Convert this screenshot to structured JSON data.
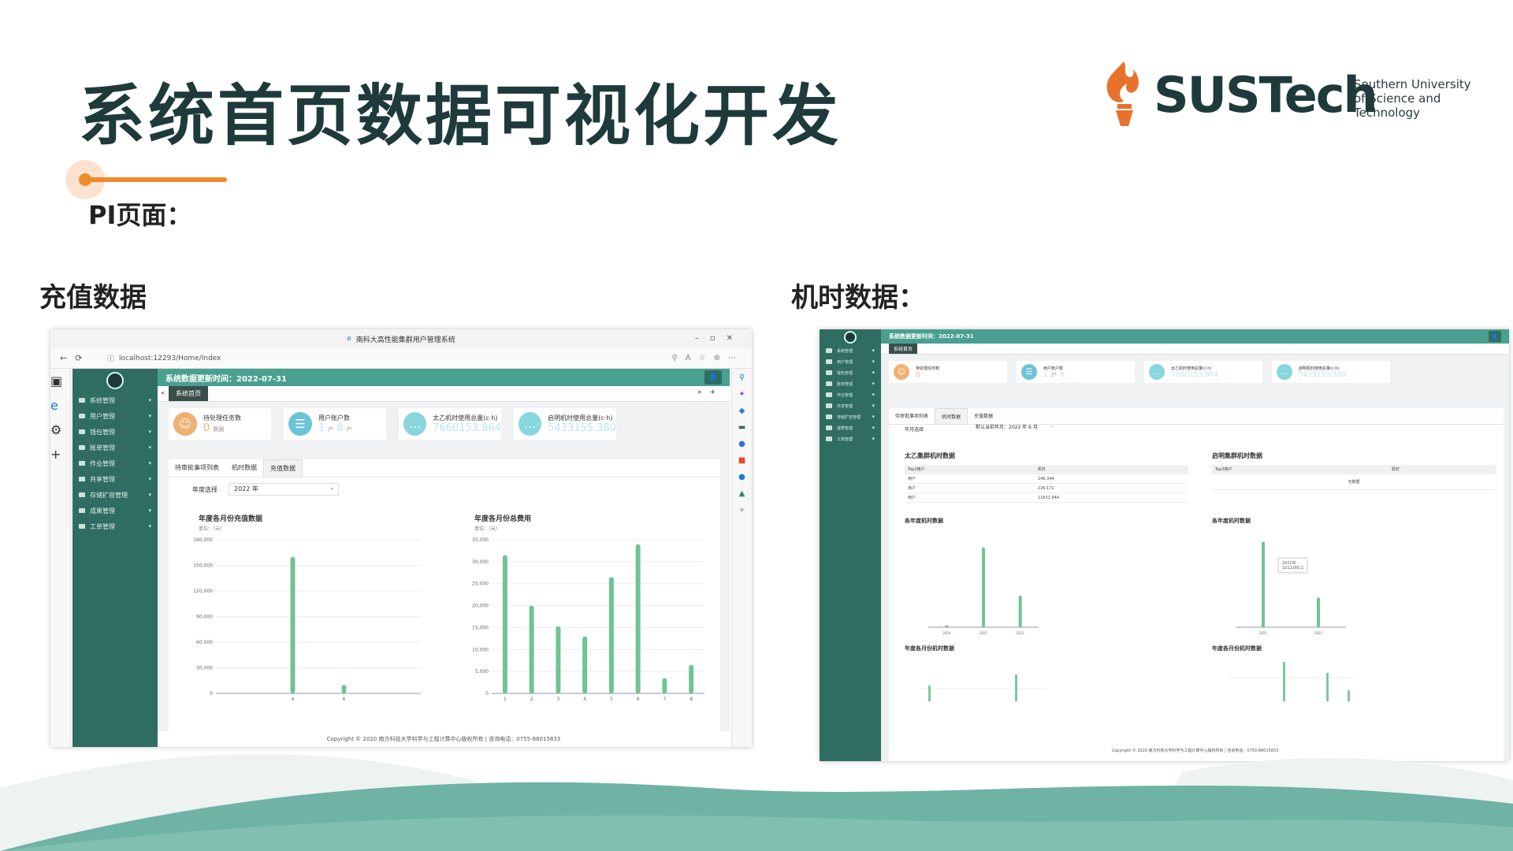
{
  "slide": {
    "title": "系统首页数据可视化开发",
    "subtitle": "PI页面：",
    "section_left": "充值数据",
    "section_right": "机时数据："
  },
  "logo": {
    "wordmark": "SUSTech",
    "line1": "Southern University",
    "line2": "of Science and",
    "line3": "Technology",
    "brand_color": "#1f3a3a",
    "flame_color": "#e8722c"
  },
  "left_shot": {
    "browser": {
      "window_title": "南科大高性能集群用户管理系统",
      "url": "localhost:12293/Home/Index"
    },
    "topbar_title": "系统数据更新时间：2022-07-31",
    "active_tab": "系统首页",
    "sidebar": [
      "系统管理",
      "用户管理",
      "钱包管理",
      "账单管理",
      "作业管理",
      "共享管理",
      "存储扩容管理",
      "成果管理",
      "工单管理"
    ],
    "stats": [
      {
        "label": "待处理任务数",
        "value": "0",
        "unit": "数据",
        "color": "#f0b070",
        "icon": "user-icon"
      },
      {
        "label": "用户账户数",
        "value": "1",
        "value2": "8",
        "unit": "户",
        "color": "#6cc3d8",
        "icon": "document-icon"
      },
      {
        "label": "太乙机时使用总量(c·h)",
        "value": "7660153.864",
        "unit": "",
        "color": "#89d6dd",
        "icon": "chat-icon"
      },
      {
        "label": "启明机时使用总量(c·h)",
        "value": "5433155.380",
        "unit": "",
        "color": "#89d6dd",
        "icon": "chat-icon"
      }
    ],
    "panel_tabs": [
      "待审批事项列表",
      "机时数据",
      "充值数据"
    ],
    "year_label": "年度选择",
    "year_value": "2022 年",
    "footer": "Copyright © 2020 南方科技大学科学与工程计算中心版权所有 | 咨询电话：0755-88015833"
  },
  "right_shot": {
    "topbar_title": "系统数据更新时间：2022-07-31",
    "active_tab": "系统首页",
    "sidebar": [
      "系统管理",
      "用户管理",
      "钱包管理",
      "账单管理",
      "作业管理",
      "共享管理",
      "存储扩容管理",
      "成果管理",
      "工单管理"
    ],
    "stats": [
      {
        "label": "待处理任务数",
        "value": "0"
      },
      {
        "label": "用户账户数",
        "value": "1",
        "value2": "8"
      },
      {
        "label": "太乙机时使用总量(c·h)",
        "value": "7660153.864"
      },
      {
        "label": "启明机时使用总量(c·h)",
        "value": "5433155.380"
      }
    ],
    "panel_tabs": [
      "待审批事项列表",
      "机时数据",
      "充值数据"
    ],
    "month_label": "年月选择",
    "month_value": "默认当前年月：2022 年 6 月",
    "table_left_title": "太乙集群机时数据",
    "table_right_title": "启明集群机时数据",
    "table_headers": [
      "Top3用户",
      "机时"
    ],
    "table_rows": [
      [
        "用户",
        "146.344"
      ],
      [
        "用户",
        "226.171"
      ],
      [
        "用户",
        "11631.944"
      ]
    ],
    "table_right_empty": "无数据",
    "chart_titles": [
      "各年度机时数据",
      "各年度机时数据",
      "年度各月份机时数据",
      "年度各月份机时数据"
    ],
    "tooltip_year": "2022年",
    "tooltip_value": "3212160.2",
    "footer": "Copyright © 2020 南方科技大学科学与工程计算中心版权所有 | 咨询电话：0755-88015833"
  },
  "chart_data": [
    {
      "type": "bar",
      "title": "年度各月份充值数据",
      "ylabel": "单位：（元）",
      "categories": [
        "4",
        "6"
      ],
      "values": [
        160000,
        10000
      ],
      "yticks": [
        0,
        30000,
        60000,
        90000,
        120000,
        150000,
        180000
      ],
      "ytick_labels": [
        "0",
        "30,000",
        "60,000",
        "90,000",
        "120,000",
        "150,000",
        "180,000"
      ],
      "ylim": [
        0,
        180000
      ]
    },
    {
      "type": "bar",
      "title": "年度各月份总费用",
      "ylabel": "单位：（元）",
      "categories": [
        "1",
        "2",
        "3",
        "4",
        "5",
        "6",
        "7",
        "8"
      ],
      "values": [
        31500,
        20000,
        15300,
        13000,
        26500,
        34000,
        3500,
        6500
      ],
      "yticks": [
        0,
        5000,
        10000,
        15000,
        20000,
        25000,
        30000,
        35000
      ],
      "ytick_labels": [
        "0",
        "5,000",
        "10,000",
        "15,000",
        "20,000",
        "25,000",
        "30,000",
        "35,000"
      ],
      "ylim": [
        0,
        35000
      ]
    },
    {
      "type": "bar",
      "title": "各年度机时数据",
      "categories": [
        "2020",
        "2021",
        "2022"
      ],
      "values": [
        100000,
        4300000,
        1700000
      ],
      "ylim": [
        0,
        5000000
      ]
    },
    {
      "type": "bar",
      "title": "各年度机时数据",
      "categories": [
        "2021",
        "2022"
      ],
      "values": [
        4600000,
        1600000
      ],
      "ylim": [
        0,
        5000000
      ]
    }
  ]
}
